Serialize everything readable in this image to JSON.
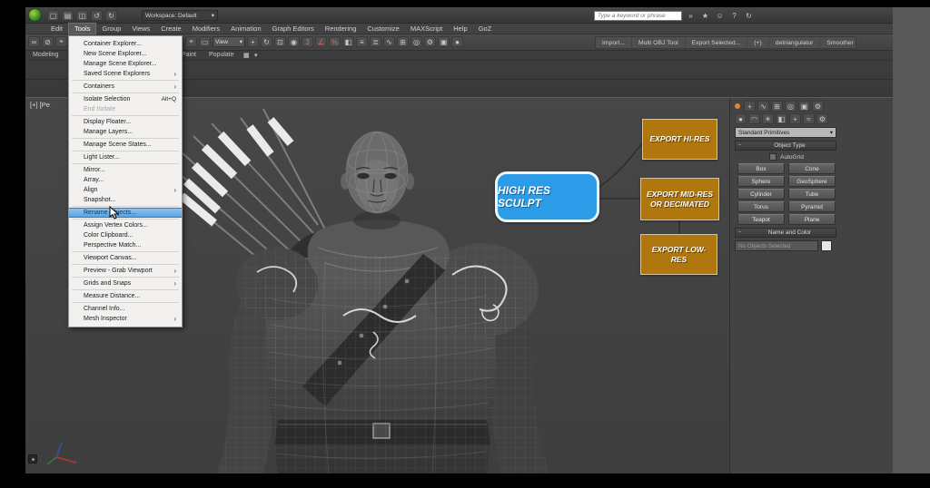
{
  "titlebar": {
    "workspace": "Workspace: Default",
    "search_placeholder": "Type a keyword or phrase"
  },
  "menubar": {
    "items": [
      "Edit",
      "Tools",
      "Group",
      "Views",
      "Create",
      "Modifiers",
      "Animation",
      "Graph Editors",
      "Rendering",
      "Customize",
      "MAXScript",
      "Help",
      "GoZ"
    ],
    "active": "Tools"
  },
  "toolbar": {
    "coord_dropdown": "View",
    "plugin_buttons": [
      "Import...",
      "Multi OBJ Tool",
      "Export Selected...",
      "(+)",
      "detriangulator",
      "Smoother"
    ]
  },
  "ribbon": {
    "tabs": [
      "Modeling",
      "Paint",
      "Populate"
    ]
  },
  "tools_menu": {
    "items": [
      {
        "label": "Container Explorer..."
      },
      {
        "label": "New Scene Explorer..."
      },
      {
        "label": "Manage Scene Explorer..."
      },
      {
        "label": "Saved Scene Explorers",
        "submenu": true
      },
      {
        "label": "Containers",
        "submenu": true
      },
      {
        "label": "Isolate Selection",
        "shortcut": "Alt+Q"
      },
      {
        "label": "End Isolate",
        "disabled": true
      },
      {
        "label": "Display Floater..."
      },
      {
        "label": "Manage Layers..."
      },
      {
        "label": "Manage Scene States..."
      },
      {
        "label": "Light Lister..."
      },
      {
        "label": "Mirror..."
      },
      {
        "label": "Array..."
      },
      {
        "label": "Align",
        "submenu": true
      },
      {
        "label": "Snapshot..."
      },
      {
        "label": "Rename Objects...",
        "highlighted": true
      },
      {
        "label": "Assign Vertex Colors..."
      },
      {
        "label": "Color Clipboard..."
      },
      {
        "label": "Perspective Match..."
      },
      {
        "label": "Viewport Canvas..."
      },
      {
        "label": "Preview - Grab Viewport",
        "submenu": true
      },
      {
        "label": "Grids and Snaps",
        "submenu": true
      },
      {
        "label": "Measure Distance..."
      },
      {
        "label": "Channel Info..."
      },
      {
        "label": "Mesh Inspector",
        "submenu": true
      }
    ]
  },
  "viewport": {
    "label": "[+] [Pe",
    "callout_high_res": "HIGH RES SCULPT",
    "callout_hi": "EXPORT HI-RES",
    "callout_mid": "EXPORT MID-RES OR DECIMATED",
    "callout_low": "EXPORT LOW-RES"
  },
  "command_panel": {
    "category_dropdown": "Standard Primitives",
    "rollout_object_type": "Object Type",
    "autogrid": "AutoGrid",
    "object_buttons": [
      "Box",
      "Cone",
      "Sphere",
      "GeoSphere",
      "Cylinder",
      "Tube",
      "Torus",
      "Pyramid",
      "Teapot",
      "Plane"
    ],
    "rollout_name_color": "Name and Color",
    "name_field": "No Objects Selected"
  },
  "icons": {
    "caret": "▾",
    "submenu": "›",
    "minus": "−",
    "new": "▢",
    "open": "▤",
    "save": "◫",
    "undo": "↺",
    "redo": "↻",
    "search_go": "»",
    "signin": "☺",
    "star": "★",
    "help": "?",
    "refresh": "↻",
    "link": "∞",
    "unlink": "⊘",
    "bind": "⌖",
    "select": "⌖",
    "rect": "▭",
    "move": "+",
    "rotate": "↻",
    "scale": "⊡",
    "pivot": "◉",
    "snap3": "3",
    "snapang": "∠",
    "snappct": "%",
    "mirror": "◧",
    "align": "≡",
    "layers": "≣",
    "curve": "∿",
    "schematic": "⊞",
    "material": "◎",
    "rendersetup": "⚙",
    "rfw": "▣",
    "render": "●",
    "tab_create": "+",
    "tab_modify": "∿",
    "tab_hier": "⊞",
    "tab_motion": "◎",
    "tab_display": "▣",
    "tab_util": "⚙",
    "cat_geom": "●",
    "cat_shapes": "◠",
    "cat_lights": "☀",
    "cat_cams": "◧",
    "cat_help": "+",
    "cat_space": "≈",
    "cat_sys": "⚙",
    "ribbon_panel": "▦"
  },
  "colors": {
    "callout_blue": "#2d9ce8",
    "callout_orange": "#b1770f",
    "menu_highlight": "#5ba2e0"
  }
}
